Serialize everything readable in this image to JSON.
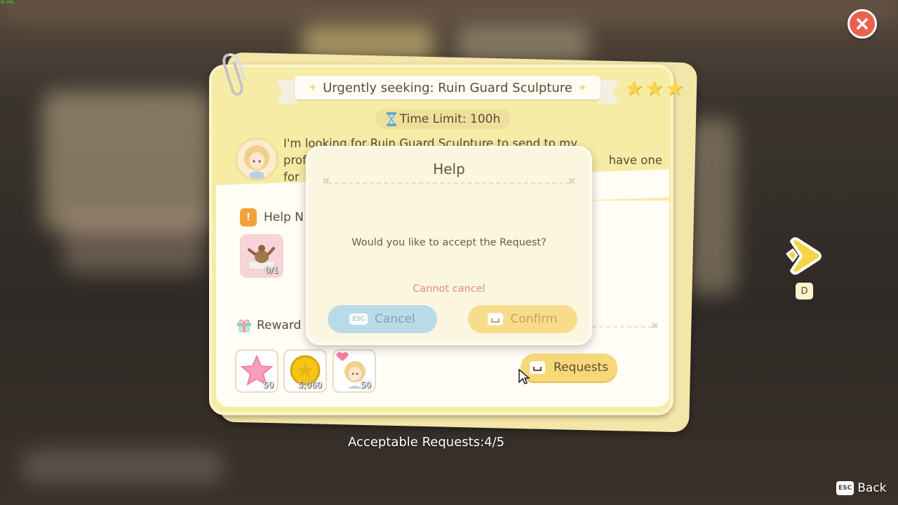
{
  "hud": {
    "fps": "60 FPS"
  },
  "request": {
    "title": "Urgently seeking: Ruin Guard Sculpture",
    "stars": 3,
    "time_limit": "Time Limit: 100h",
    "description": "I'm looking for Ruin Guard Sculpture to send to my prof... have one for...",
    "description_line1": "I'm looking for Ruin Guard Sculpture to send to my",
    "description_line2a": "prof",
    "description_line2b": "have one",
    "description_line3": "for",
    "help_needed_label": "Help N",
    "help_item": {
      "icon": "ruin-guard-sculpture-icon",
      "count": "0/1"
    },
    "reward_label": "Reward",
    "rewards": [
      {
        "icon": "pink-star-icon",
        "count": "50"
      },
      {
        "icon": "gold-coin-icon",
        "count": "5,060"
      },
      {
        "icon": "friendship-heart-icon",
        "count": "50"
      }
    ],
    "requests_button": "Requests"
  },
  "dialog": {
    "title": "Help",
    "message": "Would you like to accept the Request?",
    "warning": "Cannot cancel",
    "cancel_key": "ESC",
    "cancel_label": "Cancel",
    "confirm_label": "Confirm"
  },
  "nav": {
    "next_key": "D"
  },
  "footer": {
    "acceptable_requests": "Acceptable Requests:4/5",
    "back_key": "ESC",
    "back_label": "Back"
  },
  "colors": {
    "card": "#f7eca6",
    "accent_yellow": "#f7d879",
    "close_red": "#e8634f",
    "text_brown": "#5d4a35",
    "warning_pink": "#e48a80"
  }
}
